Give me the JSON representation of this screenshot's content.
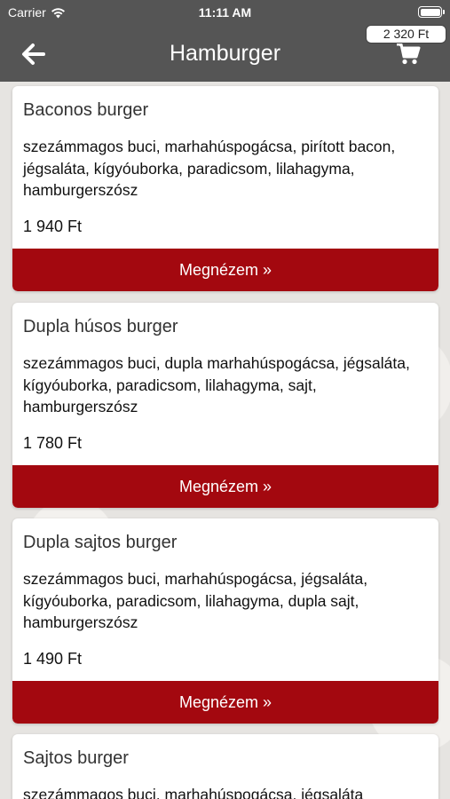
{
  "status_bar": {
    "carrier": "Carrier",
    "time": "11:11 AM",
    "battery_level": 1.0
  },
  "header": {
    "title": "Hamburger",
    "back_icon": "arrow-left-icon",
    "cart_icon": "cart-icon",
    "cart_total": "2 320 Ft",
    "background_color": "#555555"
  },
  "accent_color": "#a3080f",
  "products": [
    {
      "name": "Baconos burger",
      "description": "szezámmagos buci, marhahúspogácsa, pirított bacon, jégsaláta, kígyóuborka, paradicsom, lilahagyma, hamburgerszósz",
      "price": "1 940 Ft",
      "button_label": "Megnézem »"
    },
    {
      "name": "Dupla húsos burger",
      "description": "szezámmagos buci, dupla marhahúspogácsa, jégsaláta, kígyóuborka, paradicsom, lilahagyma, sajt, hamburgerszósz",
      "price": "1 780 Ft",
      "button_label": "Megnézem »"
    },
    {
      "name": "Dupla sajtos burger",
      "description": "szezámmagos buci, marhahúspogácsa, jégsaláta, kígyóuborka, paradicsom, lilahagyma, dupla sajt, hamburgerszósz",
      "price": "1 490 Ft",
      "button_label": "Megnézem »"
    },
    {
      "name": "Sajtos burger",
      "description": "szezámmagos buci, marhahúspogácsa, jégsaláta",
      "price": "",
      "button_label": ""
    }
  ]
}
